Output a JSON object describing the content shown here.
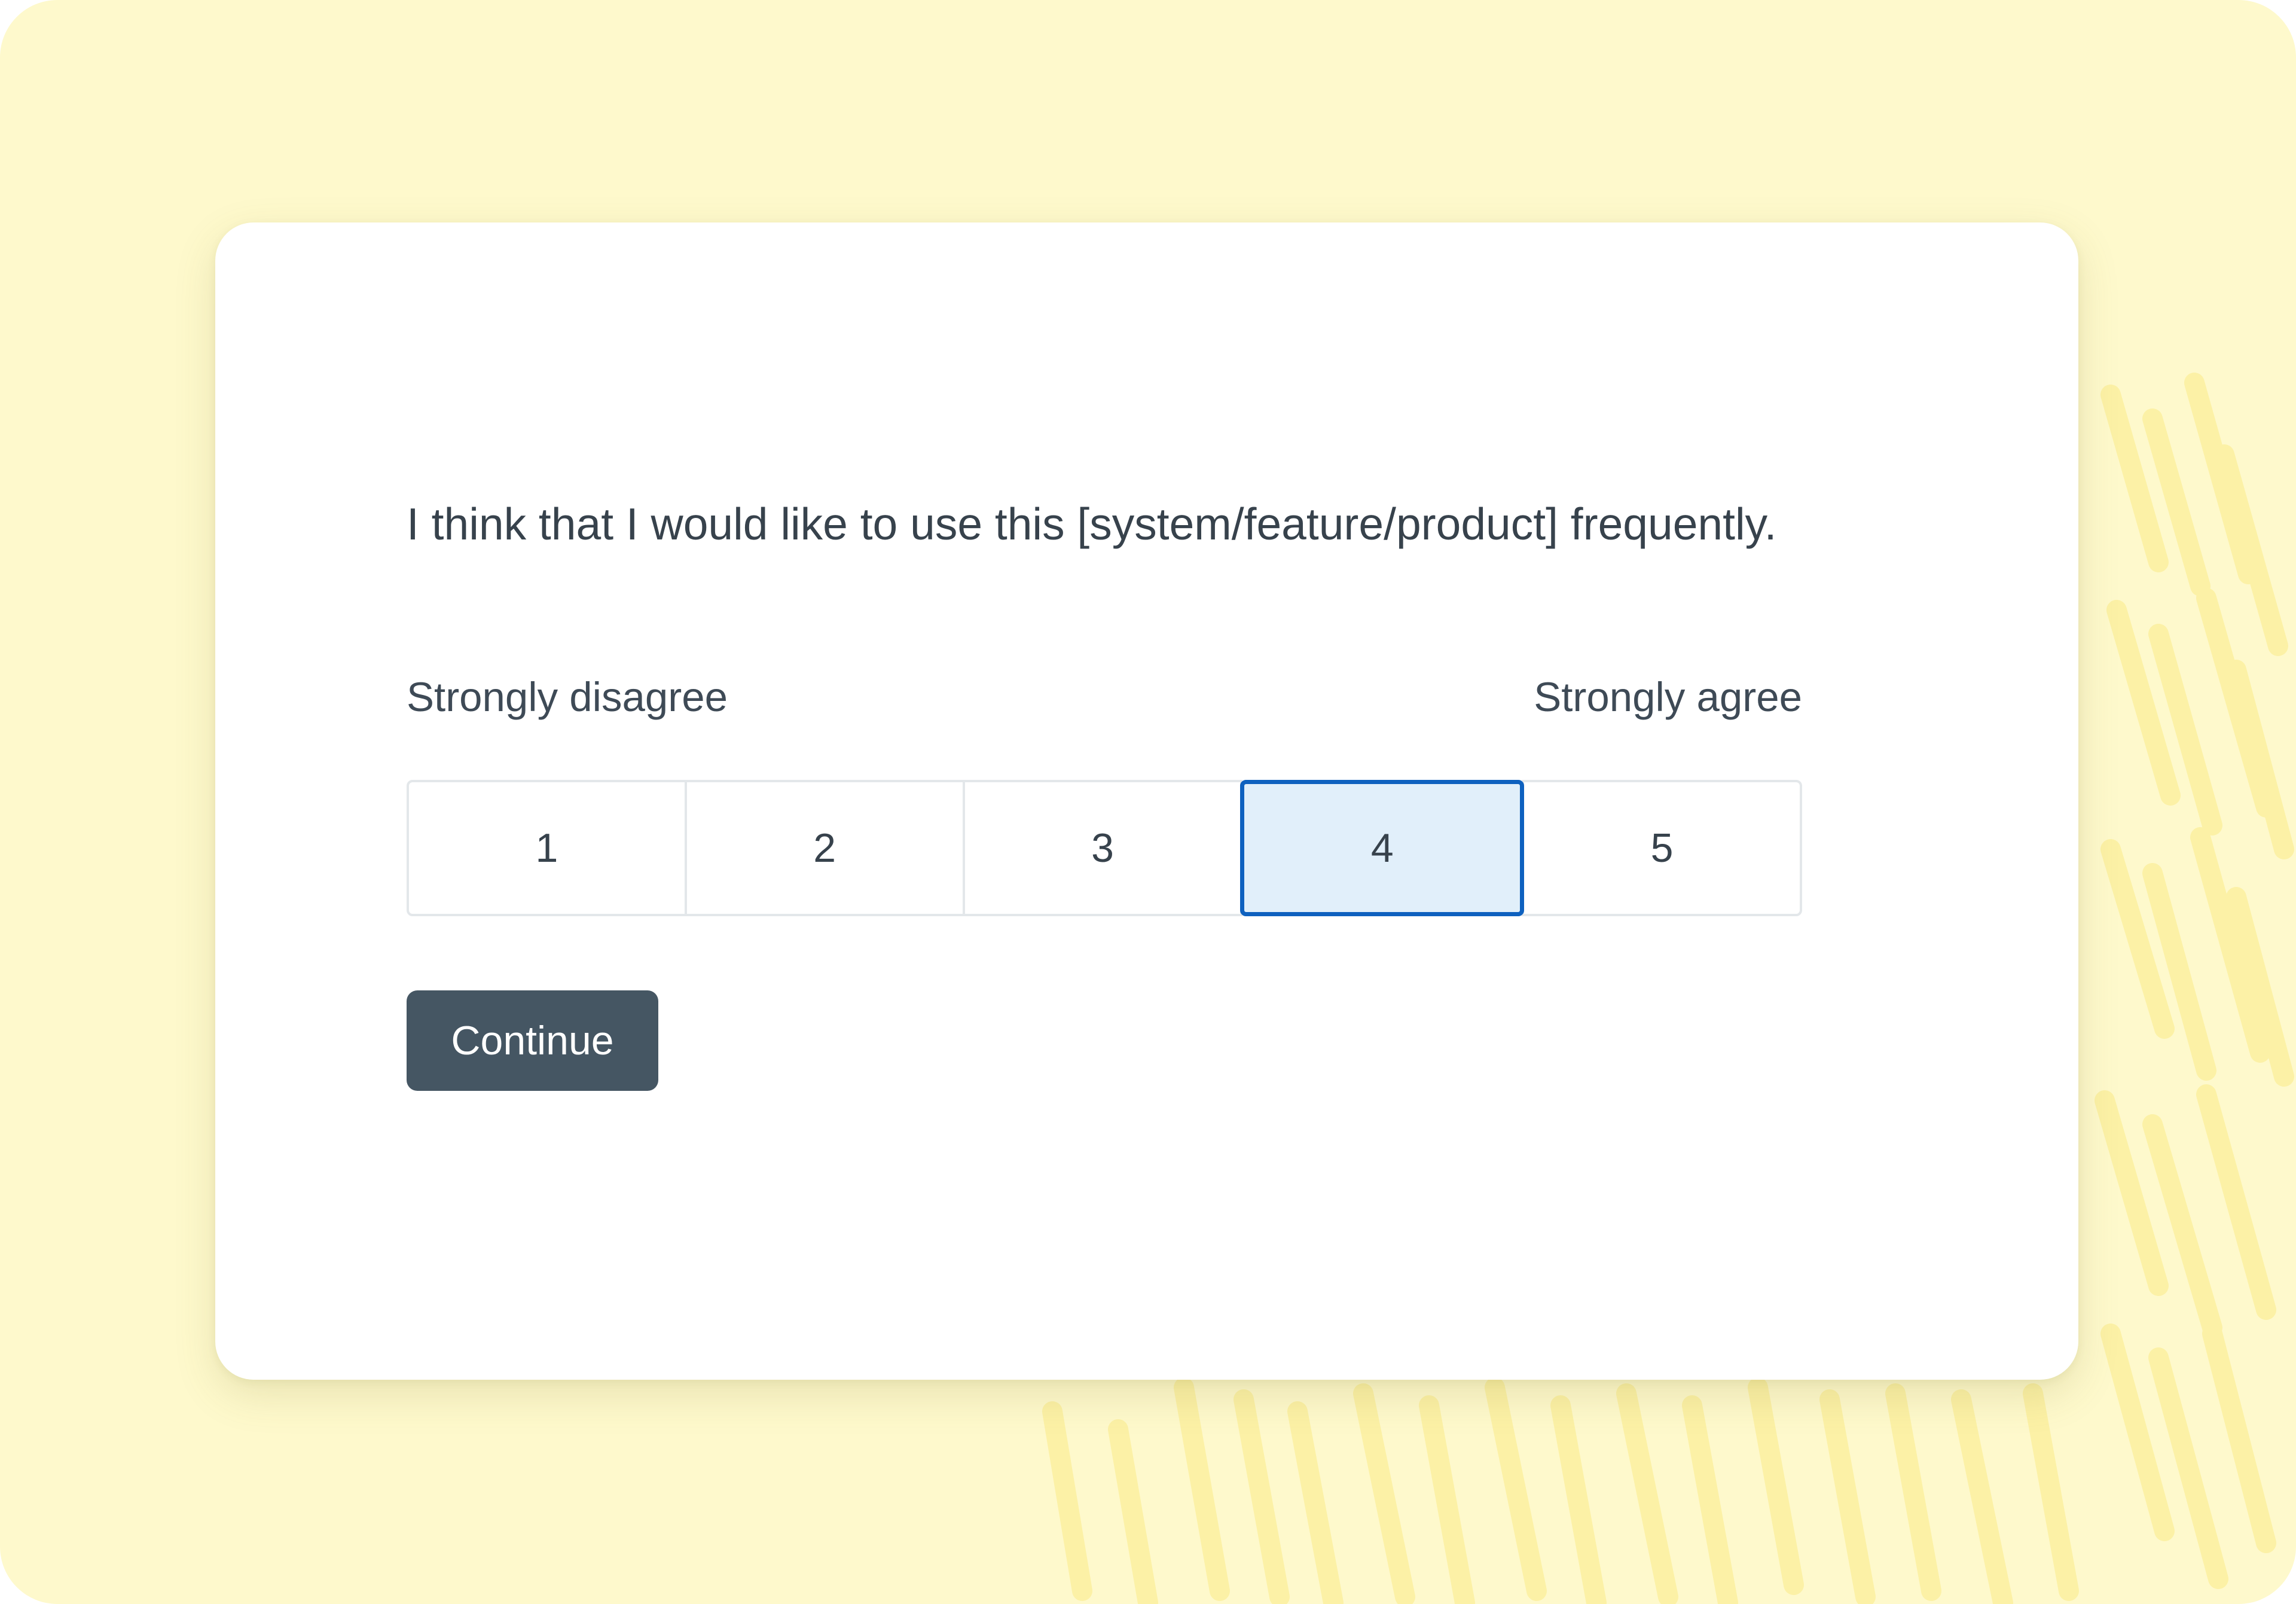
{
  "survey": {
    "question": "I think that I would like to use this [system/feature/product] frequently.",
    "scale_min_label": "Strongly disagree",
    "scale_max_label": "Strongly agree",
    "options": [
      "1",
      "2",
      "3",
      "4",
      "5"
    ],
    "selected_value": "4",
    "continue_label": "Continue"
  },
  "colors": {
    "background": "#FEF9CC",
    "decor_strokes": "#FCF1A6",
    "card": "#FFFFFF",
    "text": "#37424C",
    "selected_fill": "#E1EFFA",
    "selected_border": "#0E61BF",
    "button": "#455663",
    "button_text": "#FFFFFF"
  }
}
